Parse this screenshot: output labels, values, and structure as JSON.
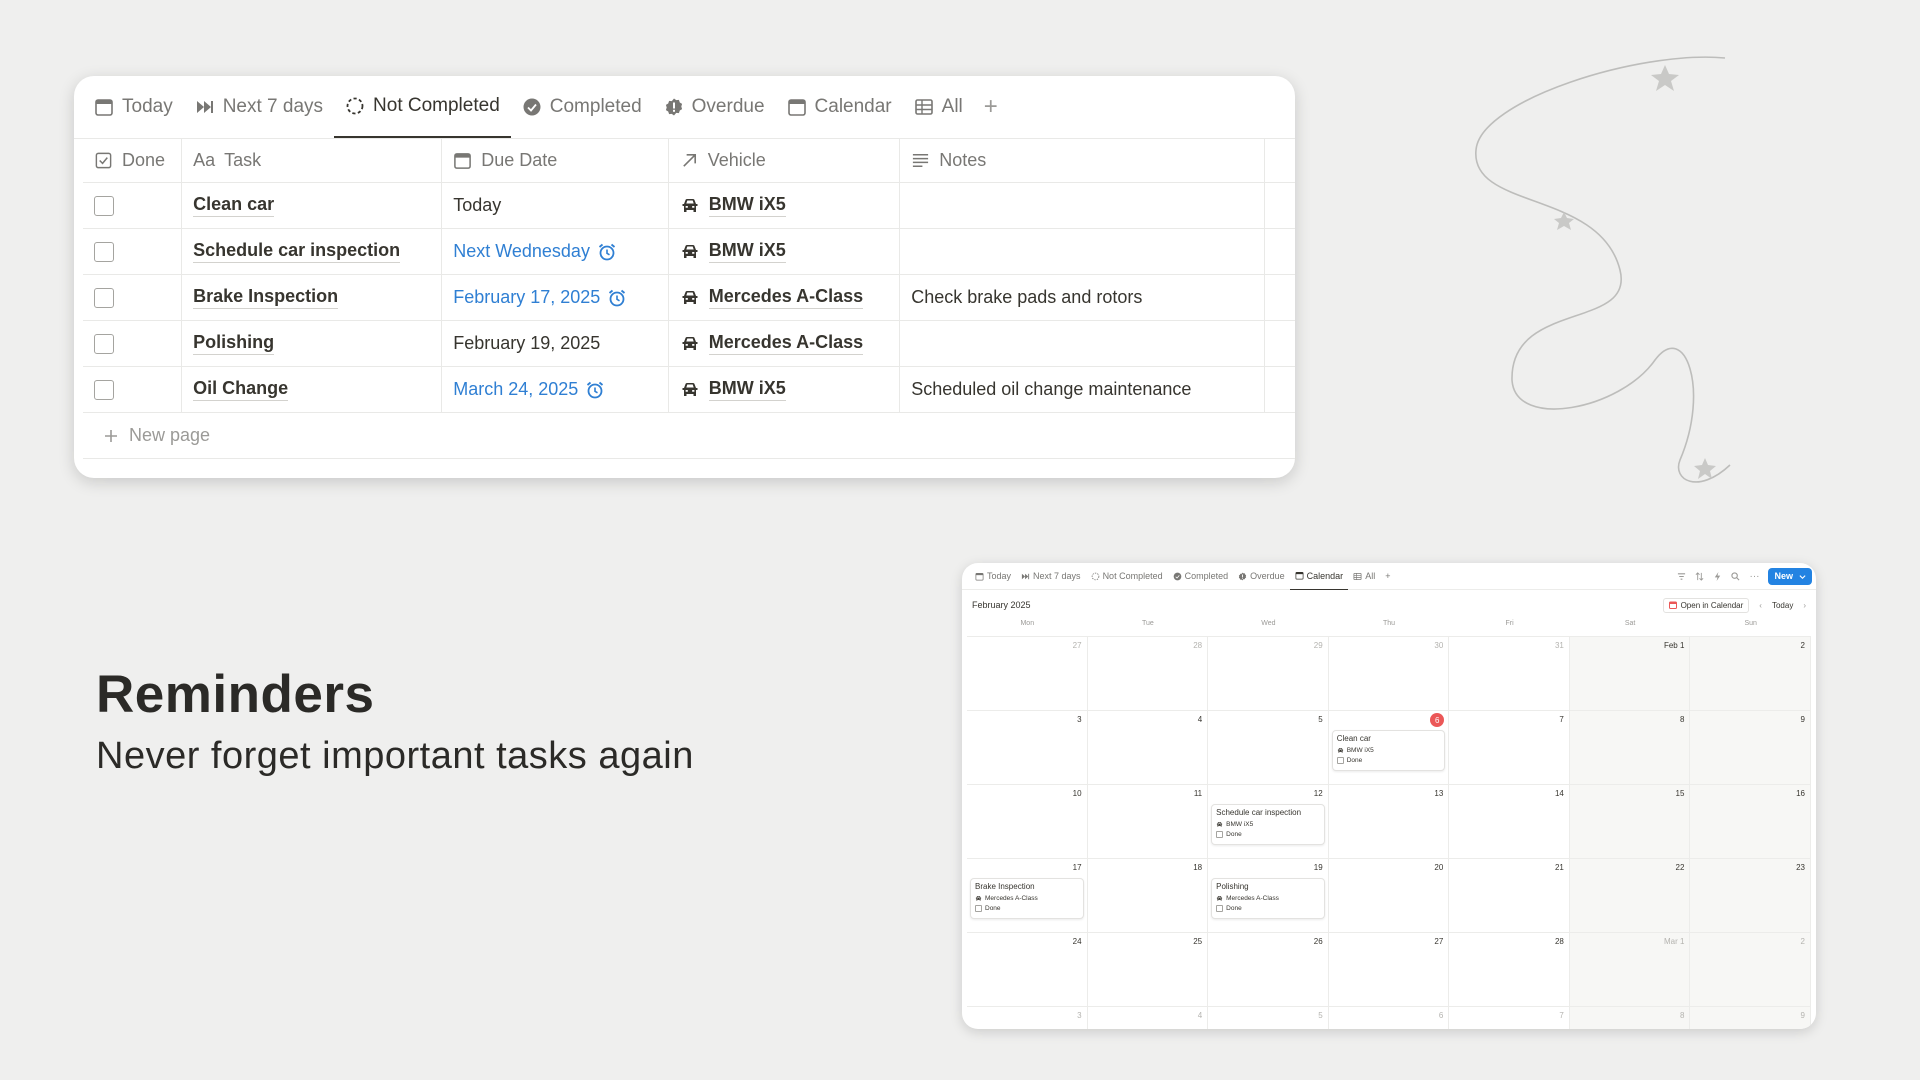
{
  "table_view": {
    "tabs": [
      {
        "label": "Today",
        "icon": "calendar-icon",
        "active": false
      },
      {
        "label": "Next 7 days",
        "icon": "fast-forward-icon",
        "active": false
      },
      {
        "label": "Not Completed",
        "icon": "dashed-circle-icon",
        "active": true
      },
      {
        "label": "Completed",
        "icon": "check-circle-icon",
        "active": false
      },
      {
        "label": "Overdue",
        "icon": "alert-badge-icon",
        "active": false
      },
      {
        "label": "Calendar",
        "icon": "calendar-icon",
        "active": false
      },
      {
        "label": "All",
        "icon": "table-icon",
        "active": false
      }
    ],
    "add_tab_symbol": "+",
    "columns": [
      {
        "label": "Done",
        "icon": "checkbox-icon"
      },
      {
        "label": "Task",
        "icon": "text-aa-icon",
        "prefix": "Aa"
      },
      {
        "label": "Due Date",
        "icon": "calendar-icon"
      },
      {
        "label": "Vehicle",
        "icon": "relation-arrow-icon"
      },
      {
        "label": "Notes",
        "icon": "lines-icon"
      }
    ],
    "rows": [
      {
        "task": "Clean car",
        "due": "Today",
        "due_highlight": false,
        "reminder": false,
        "vehicle": "BMW iX5",
        "notes": ""
      },
      {
        "task": "Schedule car inspection",
        "due": "Next Wednesday",
        "due_highlight": true,
        "reminder": true,
        "vehicle": "BMW iX5",
        "notes": ""
      },
      {
        "task": "Brake Inspection",
        "due": "February 17, 2025",
        "due_highlight": true,
        "reminder": true,
        "vehicle": "Mercedes A-Class",
        "notes": "Check brake pads and rotors"
      },
      {
        "task": "Polishing",
        "due": "February 19, 2025",
        "due_highlight": false,
        "reminder": false,
        "vehicle": "Mercedes A-Class",
        "notes": ""
      },
      {
        "task": "Oil Change",
        "due": "March 24, 2025",
        "due_highlight": true,
        "reminder": true,
        "vehicle": "BMW iX5",
        "notes": "Scheduled oil change maintenance"
      }
    ],
    "new_page_label": "New page",
    "colors": {
      "link_blue": "#2f7fd3",
      "text": "#37352f",
      "muted": "#787774"
    }
  },
  "headline": {
    "title": "Reminders",
    "subtitle": "Never forget important tasks again"
  },
  "calendar_view": {
    "tabs": [
      {
        "label": "Today",
        "active": false
      },
      {
        "label": "Next 7 days",
        "active": false
      },
      {
        "label": "Not Completed",
        "active": false
      },
      {
        "label": "Completed",
        "active": false
      },
      {
        "label": "Overdue",
        "active": false
      },
      {
        "label": "Calendar",
        "active": true
      },
      {
        "label": "All",
        "active": false
      }
    ],
    "new_button_label": "New",
    "month_label": "February 2025",
    "open_in_calendar_label": "Open in Calendar",
    "today_label": "Today",
    "weekdays": [
      "Mon",
      "Tue",
      "Wed",
      "Thu",
      "Fri",
      "Sat",
      "Sun"
    ],
    "weeks": [
      [
        "27",
        "28",
        "29",
        "30",
        "31",
        "Feb 1",
        "2"
      ],
      [
        "3",
        "4",
        "5",
        "6",
        "7",
        "8",
        "9"
      ],
      [
        "10",
        "11",
        "12",
        "13",
        "14",
        "15",
        "16"
      ],
      [
        "17",
        "18",
        "19",
        "20",
        "21",
        "22",
        "23"
      ],
      [
        "24",
        "25",
        "26",
        "27",
        "28",
        "Mar 1",
        "2"
      ],
      [
        "3",
        "4",
        "5",
        "6",
        "7",
        "8",
        "9"
      ]
    ],
    "muted_cells": [
      "0-0",
      "0-1",
      "0-2",
      "0-3",
      "0-4",
      "4-5",
      "4-6",
      "5-0",
      "5-1",
      "5-2",
      "5-3",
      "5-4",
      "5-5",
      "5-6"
    ],
    "today_cell": "1-3",
    "events": [
      {
        "cell": "1-3",
        "title": "Clean car",
        "vehicle": "BMW iX5",
        "done_label": "Done"
      },
      {
        "cell": "2-2",
        "title": "Schedule car inspection",
        "vehicle": "BMW iX5",
        "done_label": "Done"
      },
      {
        "cell": "3-0",
        "title": "Brake Inspection",
        "vehicle": "Mercedes A-Class",
        "done_label": "Done"
      },
      {
        "cell": "3-2",
        "title": "Polishing",
        "vehicle": "Mercedes A-Class",
        "done_label": "Done"
      }
    ],
    "colors": {
      "today_red": "#eb5757",
      "new_blue": "#2383e2"
    }
  }
}
